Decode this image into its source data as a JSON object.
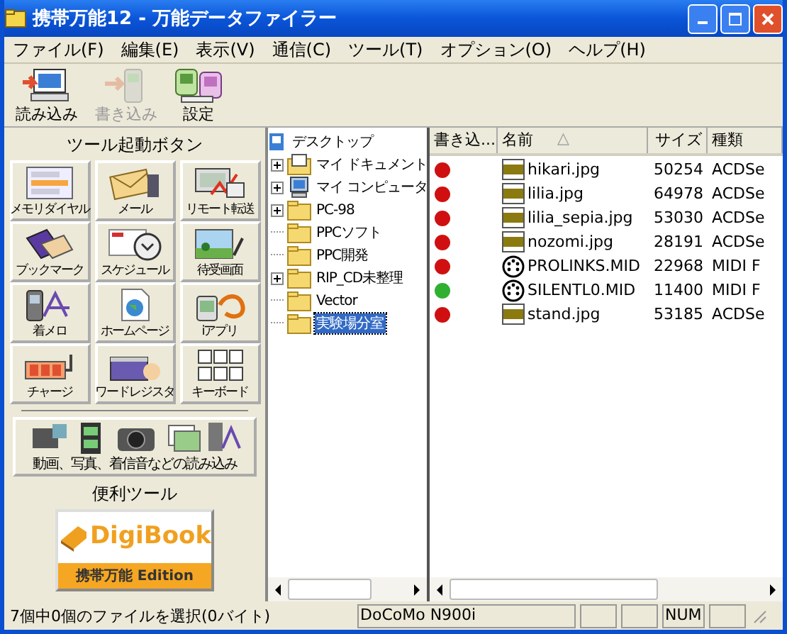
{
  "window": {
    "title": "携帯万能12 - 万能データファイラー"
  },
  "menu": [
    "ファイル(F)",
    "編集(E)",
    "表示(V)",
    "通信(C)",
    "ツール(T)",
    "オプション(O)",
    "ヘルプ(H)"
  ],
  "toolbar": [
    {
      "kind": "read",
      "label": "読み込み",
      "disabled": false
    },
    {
      "kind": "write",
      "label": "書き込み",
      "disabled": true
    },
    {
      "kind": "settings",
      "label": "設定",
      "disabled": false
    }
  ],
  "tools_panel": {
    "title": "ツール起動ボタン",
    "buttons": [
      {
        "kind": "memory",
        "label": "メモリダイヤル"
      },
      {
        "kind": "mail",
        "label": "メール"
      },
      {
        "kind": "remote",
        "label": "リモート転送"
      },
      {
        "kind": "bookmark",
        "label": "ブックマーク"
      },
      {
        "kind": "schedule",
        "label": "スケジュール"
      },
      {
        "kind": "wallpaper",
        "label": "待受画面"
      },
      {
        "kind": "melody",
        "label": "着メロ"
      },
      {
        "kind": "homepage",
        "label": "ホームページ"
      },
      {
        "kind": "appli",
        "label": "iアプリ"
      },
      {
        "kind": "charge",
        "label": "チャージ"
      },
      {
        "kind": "word",
        "label": "ワードレジスタ"
      },
      {
        "kind": "keyboard",
        "label": "キーボード"
      }
    ],
    "media_button": "動画、写真、着信音などの読み込み",
    "utilities_title": "便利ツール",
    "digibook": {
      "logo": "DigiBook",
      "edition": "携帯万能 Edition"
    }
  },
  "tree": {
    "label": "デスクトップ",
    "children": [
      {
        "label": "マイ ドキュメント",
        "kind": "documents",
        "expandable": true,
        "selected": false
      },
      {
        "label": "マイ コンピュータ",
        "kind": "computer",
        "expandable": true,
        "selected": false
      },
      {
        "label": "PC-98",
        "kind": "folder",
        "expandable": true,
        "selected": false
      },
      {
        "label": "PPCソフト",
        "kind": "folder",
        "expandable": false,
        "selected": false
      },
      {
        "label": "PPC開発",
        "kind": "folder",
        "expandable": false,
        "selected": false
      },
      {
        "label": "RIP_CD未整理",
        "kind": "folder",
        "expandable": true,
        "selected": false
      },
      {
        "label": "Vector",
        "kind": "folder",
        "expandable": false,
        "selected": false
      },
      {
        "label": "実験場分室",
        "kind": "folder",
        "expandable": false,
        "selected": true
      }
    ]
  },
  "file_list": {
    "columns": [
      "書き込...",
      "名前",
      "サイズ",
      "種類"
    ],
    "sort_marker": "△",
    "rows": [
      {
        "color": "#d01010",
        "kind": "jpg",
        "name": "hikari.jpg",
        "size": "50254",
        "type": "ACDSe"
      },
      {
        "color": "#d01010",
        "kind": "jpg",
        "name": "lilia.jpg",
        "size": "64978",
        "type": "ACDSe"
      },
      {
        "color": "#d01010",
        "kind": "jpg",
        "name": "lilia_sepia.jpg",
        "size": "53030",
        "type": "ACDSe"
      },
      {
        "color": "#d01010",
        "kind": "jpg",
        "name": "nozomi.jpg",
        "size": "28191",
        "type": "ACDSe"
      },
      {
        "color": "#d01010",
        "kind": "midi",
        "name": "PROLINKS.MID",
        "size": "22968",
        "type": "MIDI F"
      },
      {
        "color": "#30b030",
        "kind": "midi",
        "name": "SILENTL0.MID",
        "size": "11400",
        "type": "MIDI F"
      },
      {
        "color": "#d01010",
        "kind": "jpg",
        "name": "stand.jpg",
        "size": "53185",
        "type": "ACDSe"
      }
    ]
  },
  "status_bar": [
    "7個中0個のファイルを選択(0バイト)",
    "DoCoMo N900i",
    "NUM"
  ]
}
